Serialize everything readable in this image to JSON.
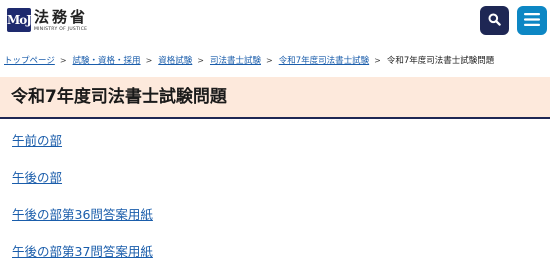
{
  "header": {
    "logo_mark": "MoJ",
    "logo_jp": "法務省",
    "logo_en": "MINISTRY OF JUSTICE",
    "search_icon": "search-icon",
    "menu_icon": "hamburger-menu-icon",
    "colors": {
      "search_button": "#1e2754",
      "menu_button": "#0d87c4",
      "logo_mark": "#1e2a6e"
    }
  },
  "breadcrumb": {
    "items": [
      "トップページ",
      "試験・資格・採用",
      "資格試験",
      "司法書士試験",
      "令和7年度司法書士試験"
    ],
    "current": "令和7年度司法書士試験問題",
    "separator_icon": "chevron-right-icon"
  },
  "main": {
    "title": "令和7年度司法書士試験問題",
    "links": [
      "午前の部",
      "午後の部",
      "午後の部第36問答案用紙",
      "午後の部第37問答案用紙"
    ],
    "colors": {
      "title_band": "#fde9dc",
      "title_rule": "#1e2754",
      "link": "#1a5dab"
    }
  }
}
